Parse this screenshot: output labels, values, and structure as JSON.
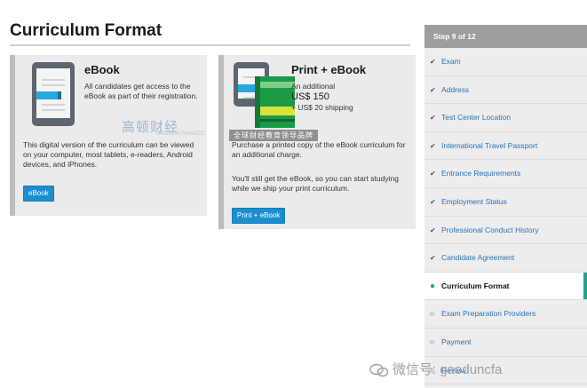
{
  "page": {
    "title": "Curriculum Format"
  },
  "cards": {
    "ebook": {
      "heading": "eBook",
      "description": "All candidates get access to the eBook as part of their registration.",
      "body": "This digital version of the curriculum can be viewed on your computer, most tablets, e-readers, Android devices, and iPhones.",
      "button_label": "eBook"
    },
    "print": {
      "heading": "Print + eBook",
      "price_prefix": "An additional",
      "price": "US$ 150",
      "shipping": "+ US$ 20 shipping",
      "body1": "Purchase a printed copy of the eBook curriculum for an additional charge.",
      "body2": "You'll still get the eBook, so you can start studying while we ship your print curriculum.",
      "button_label": "Print + eBook"
    }
  },
  "sidebar": {
    "header": "Step 9 of 12",
    "steps": [
      {
        "label": "Exam",
        "state": "done"
      },
      {
        "label": "Address",
        "state": "done"
      },
      {
        "label": "Test Center Location",
        "state": "done"
      },
      {
        "label": "International Travel Passport",
        "state": "done"
      },
      {
        "label": "Entrance Requirements",
        "state": "done"
      },
      {
        "label": "Employment Status",
        "state": "done"
      },
      {
        "label": "Professional Conduct History",
        "state": "done"
      },
      {
        "label": "Candidate Agreement",
        "state": "done"
      },
      {
        "label": "Curriculum Format",
        "state": "current"
      },
      {
        "label": "Exam Preparation Providers",
        "state": "pending"
      },
      {
        "label": "Payment",
        "state": "pending"
      },
      {
        "label": "Review",
        "state": "pending"
      }
    ],
    "marks": {
      "done": "✔",
      "current": "●",
      "pending": "○"
    }
  },
  "watermarks": {
    "brand": "高顿财经",
    "brand_sub": "GAODUN FINANCE",
    "slogan": "全球财经教育领导品牌",
    "wechat": "微信号: gaoduncfa"
  },
  "colors": {
    "button": "#1a8fd1",
    "link": "#2573b8",
    "accent": "#1fa38f",
    "sidebar_header": "#9e9e9e"
  }
}
